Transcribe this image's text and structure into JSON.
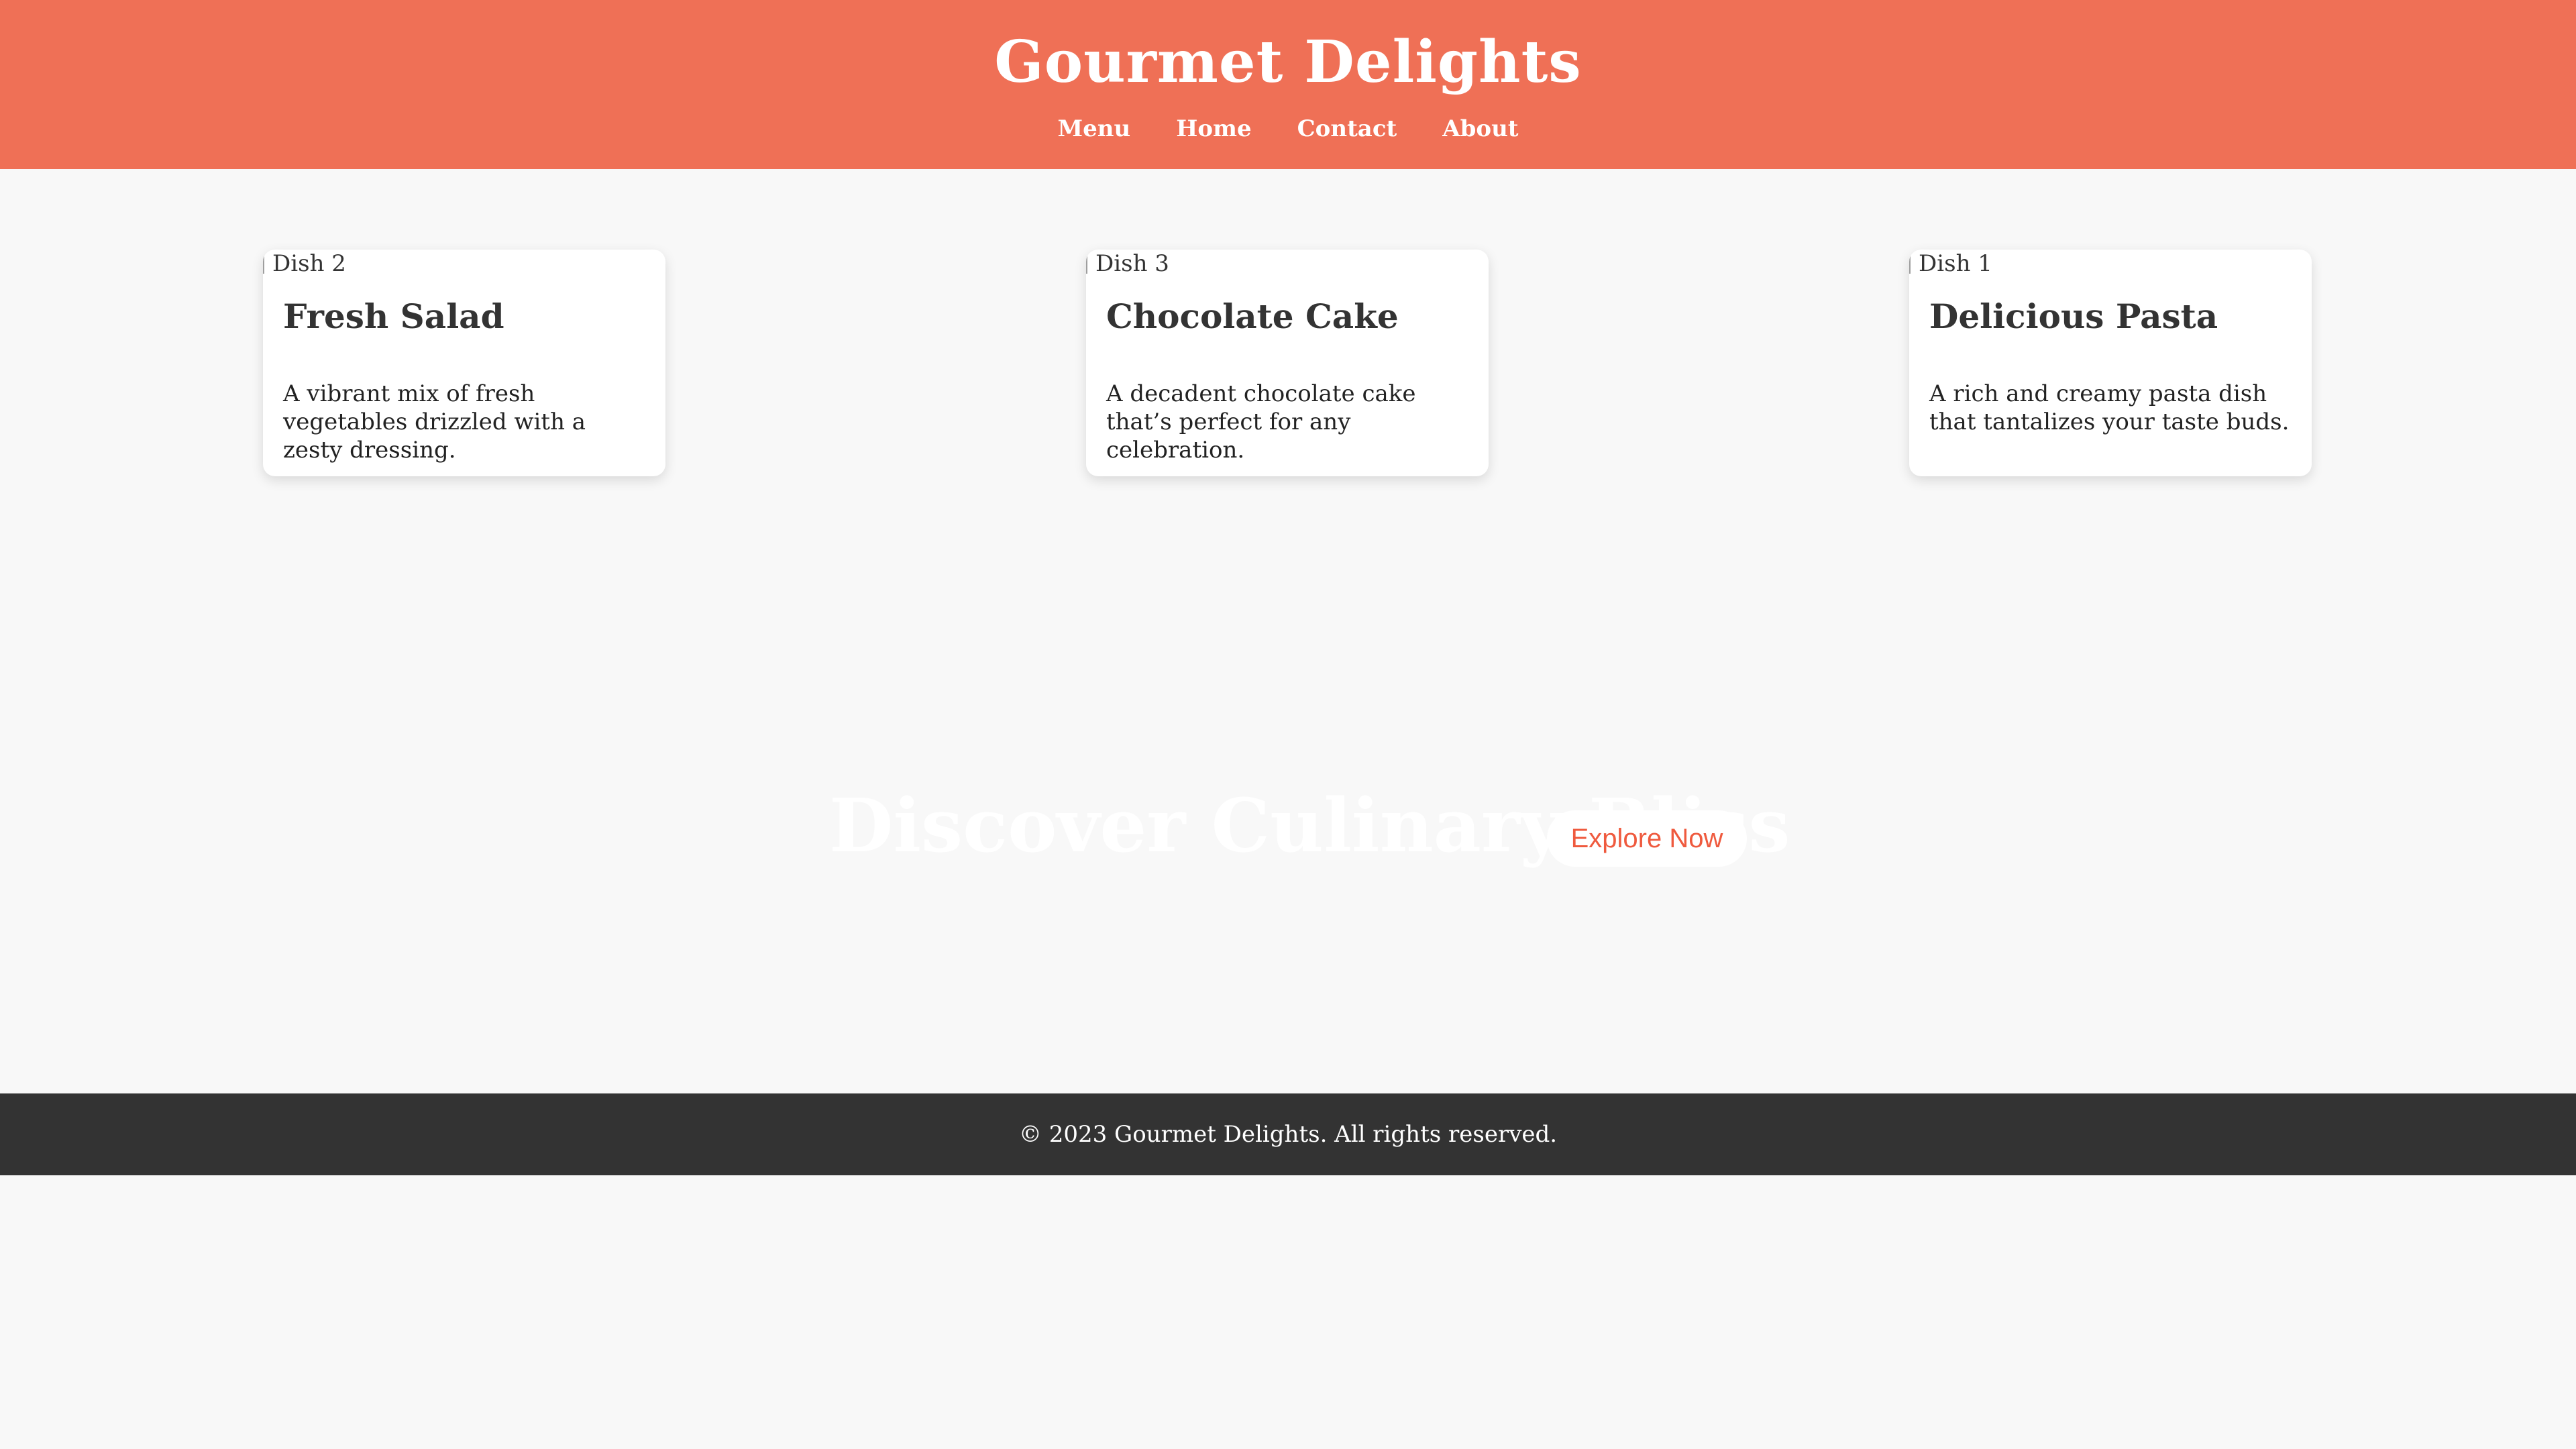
{
  "header": {
    "title": "Gourmet Delights",
    "nav": [
      "Menu",
      "Home",
      "Contact",
      "About"
    ]
  },
  "dishes": [
    {
      "image_alt": "Dish 2",
      "title": "Fresh Salad",
      "description": "A vibrant mix of fresh vegetables drizzled with a zesty dressing."
    },
    {
      "image_alt": "Dish 3",
      "title": "Chocolate Cake",
      "description": "A decadent chocolate cake that’s perfect for any celebration."
    },
    {
      "image_alt": "Dish 1",
      "title": "Delicious Pasta",
      "description": "A rich and creamy pasta dish that tantalizes your taste buds."
    }
  ],
  "hero": {
    "title": "Discover Culinary Bliss",
    "button_label": "Explore Now"
  },
  "footer": {
    "text": "© 2023 Gourmet Delights. All rights reserved."
  },
  "colors": {
    "header_bg": "#ef7056",
    "page_bg": "#f8f8f8",
    "footer_bg": "#333333",
    "accent": "#ef5a3e"
  }
}
